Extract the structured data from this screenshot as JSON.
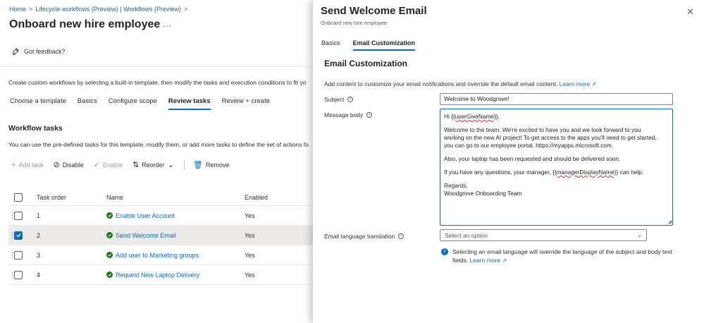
{
  "breadcrumb": {
    "items": [
      "Home",
      "Lifecycle workflows (Preview) | Workflows (Preview)"
    ],
    "separator": ">"
  },
  "page": {
    "title": "Onboard new hire employee",
    "more": "...",
    "feedback_label": "Got feedback?",
    "intro": "Create custom workflows by selecting a built-in template, then modify the tasks and execution conditions to fit yo"
  },
  "wizard_tabs": [
    "Choose a template",
    "Basics",
    "Configure scope",
    "Review tasks",
    "Review + create"
  ],
  "wizard_active": "Review tasks",
  "workflow_tasks": {
    "title": "Workflow tasks",
    "description": "You can use the pre-defined tasks for this template, modify them, or add more tasks to define the set of actions fo",
    "commands": {
      "add_task": "Add task",
      "disable": "Disable",
      "enable": "Enable",
      "reorder": "Reorder",
      "remove": "Remove"
    },
    "columns": {
      "order": "Task order",
      "name": "Name",
      "enabled": "Enabled"
    },
    "rows": [
      {
        "order": "1",
        "name": "Enable User Account",
        "enabled": "Yes",
        "selected": false
      },
      {
        "order": "2",
        "name": "Send Welcome Email",
        "enabled": "Yes",
        "selected": true
      },
      {
        "order": "3",
        "name": "Add user to Marketing groups",
        "enabled": "Yes",
        "selected": false
      },
      {
        "order": "4",
        "name": "Request New Laptop Delivery",
        "enabled": "Yes",
        "selected": false
      }
    ]
  },
  "panel": {
    "title": "Send Welcome Email",
    "subtitle": "Onboard new hire employee",
    "close": "✕",
    "tabs": [
      "Basics",
      "Email Customization"
    ],
    "active_tab": "Email Customization",
    "heading": "Email Customization",
    "description": "Add content to customize your email notifications and override the default email content.",
    "learn_more": "Learn more",
    "subject_label": "Subject",
    "subject_value": "Welcome to Woodgrove!",
    "body_label": "Message body",
    "body": {
      "greeting_prefix": "Hi ",
      "greeting_token": "{{userGiveName}}",
      "greeting_suffix": ",",
      "p1_line1": "Welcome to the team. We're excited to have you and we look forward to you",
      "p1_line2": "working on the new AI project! To get access to the apps you'll need to get started,",
      "p1_line3": "you can go to our employee portal, https://myapps.microsoft.com.",
      "p2": "Also, your laptop has been requested and should be delivered soon.",
      "p3_prefix": "If you have any questions, your manager, ",
      "p3_token": "{{managerDisplayName}}",
      "p3_suffix": " can help.",
      "signoff": "Regards,",
      "signature": "Woodgrove Onboarding Team"
    },
    "language_label": "Email language translation",
    "language_placeholder": "Select an option",
    "language_note_line1": "Selecting an email language will override the language of the subject and body text",
    "language_note_line2": "fields.",
    "language_learn_more": "Learn more"
  },
  "colors": {
    "accent": "#0f6cbd",
    "success": "#107c10",
    "selected_row": "#edebe9"
  }
}
